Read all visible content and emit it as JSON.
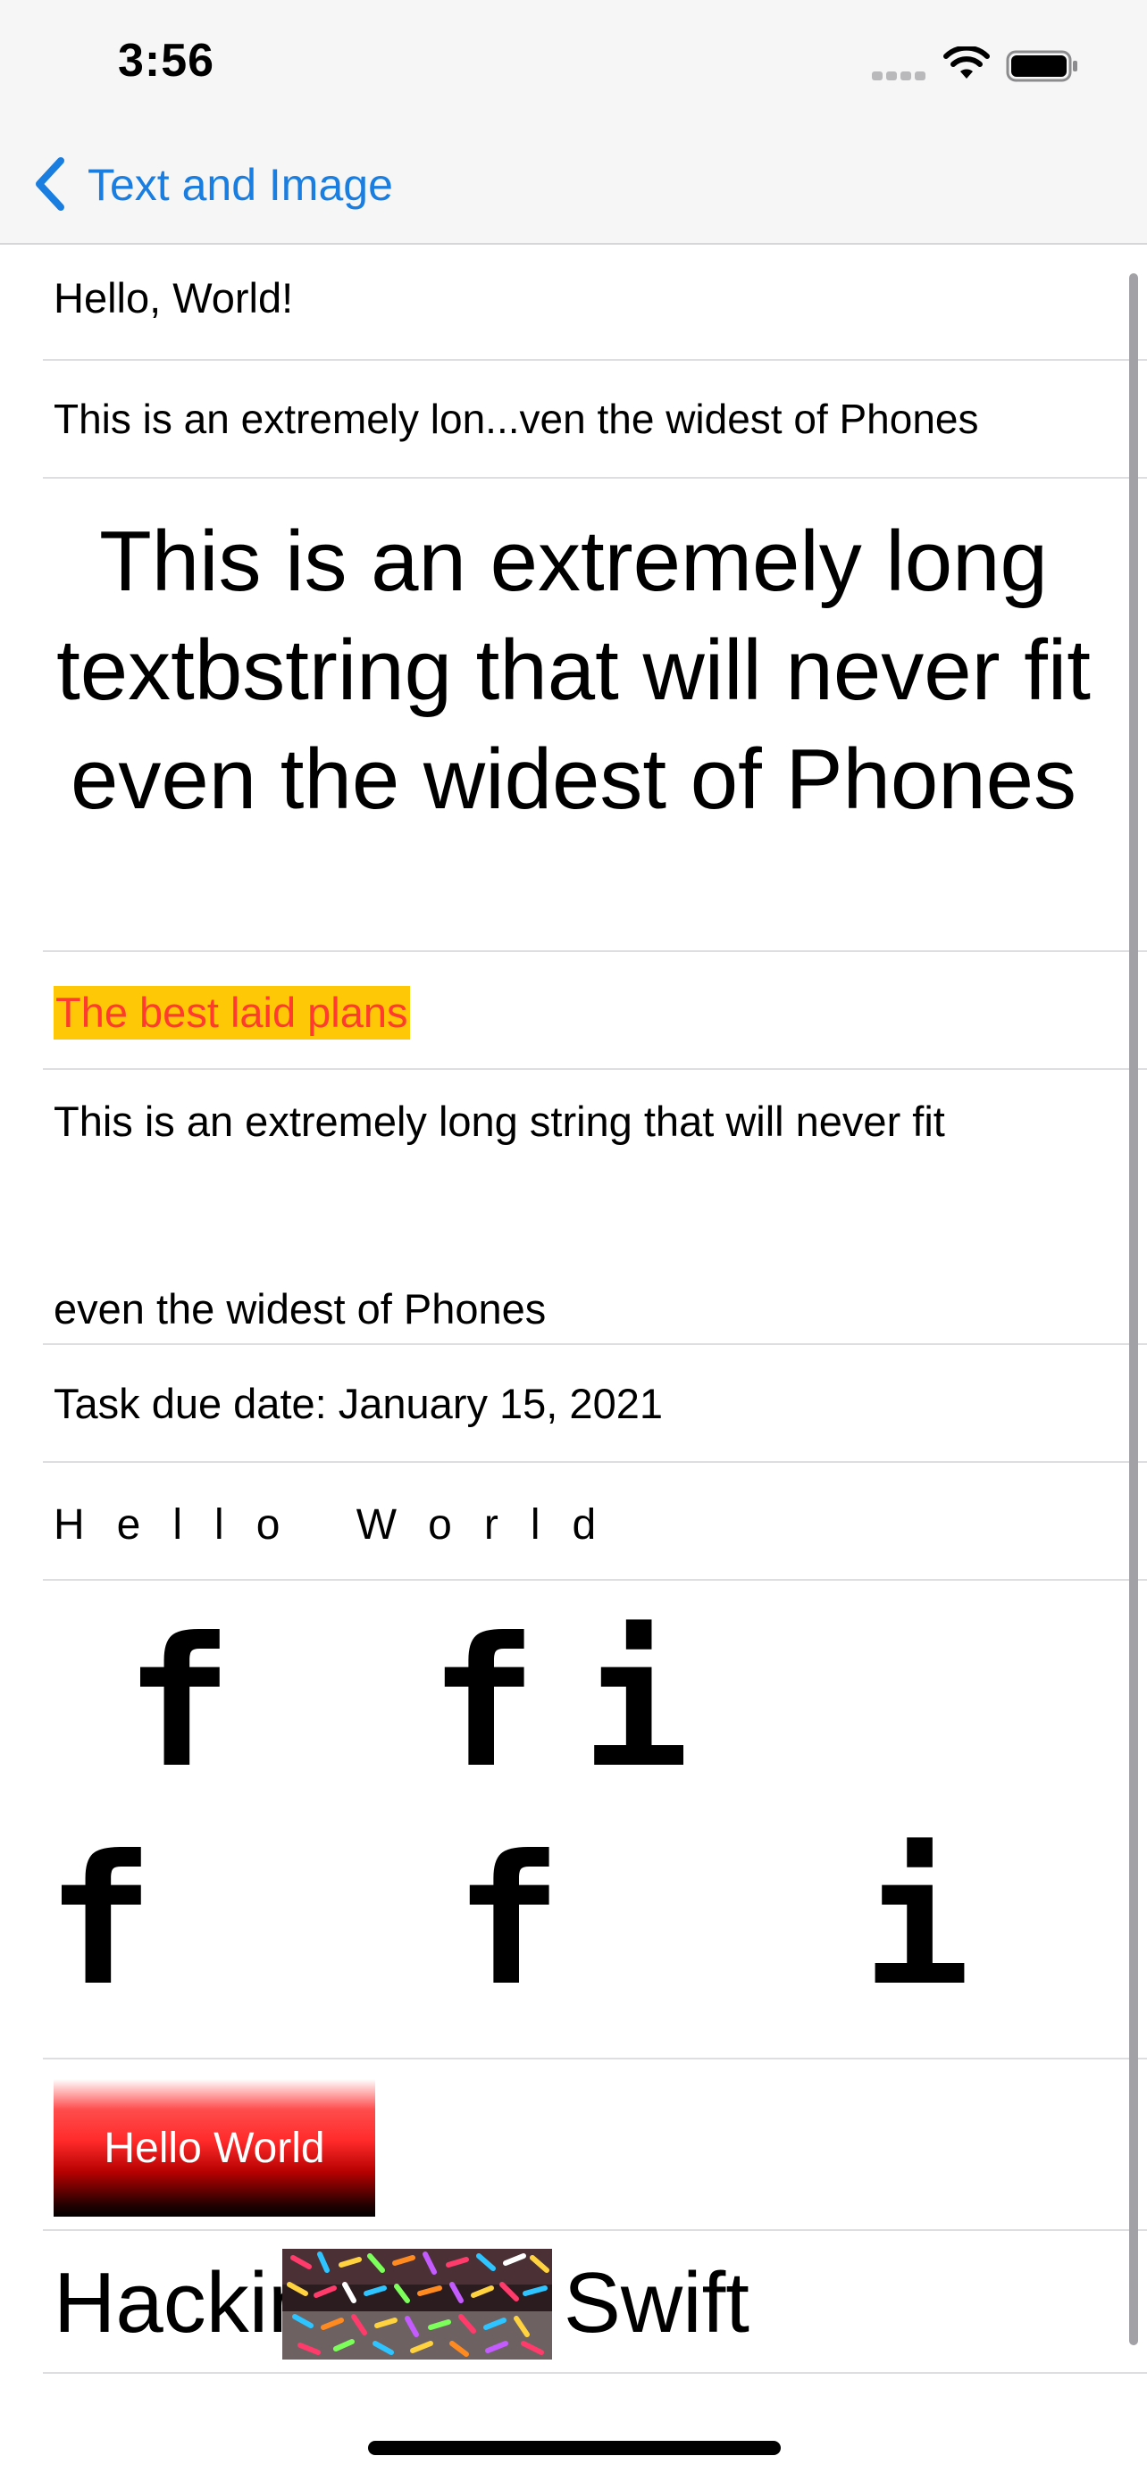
{
  "status_bar": {
    "time": "3:56",
    "icons": [
      "cellular-signal-icon",
      "wifi-icon",
      "battery-icon"
    ]
  },
  "nav": {
    "back_label": "Text and Image",
    "back_icon": "chevron-left-icon",
    "accent_color": "#1a7ee0"
  },
  "rows": {
    "hello": "Hello, World!",
    "truncated": "This is an extremely lon...ven the widest of Phones",
    "big": "This is an extremely long textbstring that will never fit even the widest of Phones",
    "highlight": {
      "text": "The best laid plans",
      "background_color": "#ffc807",
      "text_color": "#ff3b30"
    },
    "long_line1": "This is an extremely long string that will never fit",
    "long_line2": "even the widest of Phones",
    "due_date": "Task due date: January 15, 2021",
    "spaced": "Hello World",
    "ligature_line1": "f fi",
    "ligature_line2": "f f i",
    "gradient_label": "Hello World",
    "hacking": "Hacking with Swift"
  }
}
